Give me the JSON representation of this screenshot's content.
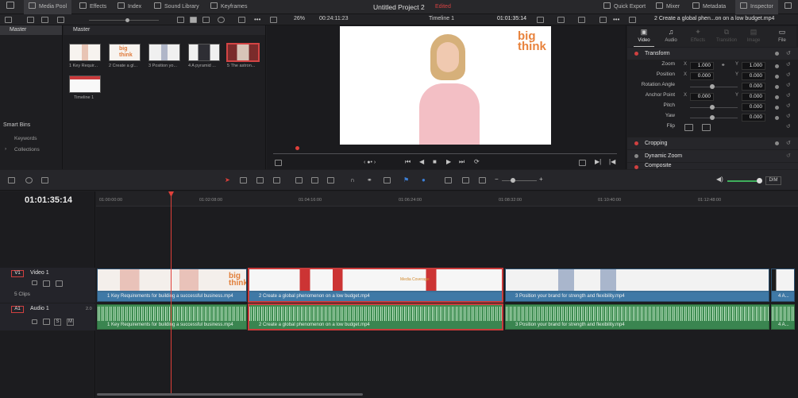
{
  "app": {
    "project_title": "Untitled Project 2",
    "edited_label": "Edited"
  },
  "topbar": {
    "media_pool": "Media Pool",
    "effects": "Effects",
    "index": "Index",
    "sound_library": "Sound Library",
    "keyframes": "Keyframes",
    "quick_export": "Quick Export",
    "mixer": "Mixer",
    "metadata": "Metadata",
    "inspector": "Inspector"
  },
  "viewer_bar": {
    "zoom": "26%",
    "source_timecode": "00:24:11:23",
    "timeline_name": "Timeline 1",
    "record_timecode": "01:01:35:14",
    "clip_name": "2 Create a global phen...on on a low budget.mp4"
  },
  "media_pool": {
    "bin_header": "Master",
    "grid_header": "Master",
    "clips": [
      {
        "label": "1 Key Requir..."
      },
      {
        "label": "2 Create a gl..."
      },
      {
        "label": "3 Position yo..."
      },
      {
        "label": "4 A pyramid ..."
      },
      {
        "label": "5 The astron..."
      },
      {
        "label": "Timeline 1"
      }
    ],
    "smart_bins": "Smart Bins",
    "keywords": "Keywords",
    "collections": "Collections"
  },
  "viewer": {
    "logo_line1": "big",
    "logo_line2": "think"
  },
  "inspector": {
    "tabs": [
      "Video",
      "Audio",
      "Effects",
      "Transition",
      "Image",
      "File"
    ],
    "transform_title": "Transform",
    "rows": [
      {
        "label": "Zoom",
        "x": "1.000",
        "y": "1.000"
      },
      {
        "label": "Position",
        "x": "0.000",
        "y": "0.000"
      },
      {
        "label": "Rotation Angle",
        "value": "0.000"
      },
      {
        "label": "Anchor Point",
        "x": "0.000",
        "y": "0.000"
      },
      {
        "label": "Pitch",
        "value": "0.000"
      },
      {
        "label": "Yaw",
        "value": "0.000"
      },
      {
        "label": "Flip"
      }
    ],
    "axis_x": "X",
    "axis_y": "Y",
    "cropping": "Cropping",
    "dynamic_zoom": "Dynamic Zoom",
    "composite": "Composite"
  },
  "timeline": {
    "timecode": "01:01:35:14",
    "ruler": [
      "01:00:00:00",
      "01:02:08:00",
      "01:04:16:00",
      "01:06:24:00",
      "01:08:32:00",
      "01:10:40:00",
      "01:12:48:00"
    ],
    "v1_tag": "V1",
    "v1_name": "Video 1",
    "clip_count": "5 Clips",
    "a1_tag": "A1",
    "a1_name": "Audio 1",
    "a1_level": "2.0",
    "solo": "S",
    "mute": "M",
    "dim": "DIM",
    "video_clips": [
      "1 Key Requirements for building a successful business.mp4",
      "2 Create a global phenomenon on a low budget.mp4",
      "3 Position your brand for strength and flexibility.mp4",
      "4 A..."
    ],
    "audio_clips": [
      "1 Key Requirements for building a successful business.mp4",
      "2 Create a global phenomenon on a low budget.mp4",
      "3 Position your brand for strength and flexibility.mp4",
      "4 A..."
    ],
    "overlay_text": "Media Coverage"
  },
  "colors": {
    "accent_red": "#d64242",
    "video_clip": "#3f79a6",
    "audio_clip": "#3f8d52",
    "playhead": "#e0403a"
  },
  "icons": [
    "media-pool-icon",
    "effects-icon",
    "index-icon",
    "sound-library-icon",
    "keyframes-icon",
    "quick-export-icon",
    "mixer-icon",
    "metadata-icon",
    "inspector-icon"
  ]
}
